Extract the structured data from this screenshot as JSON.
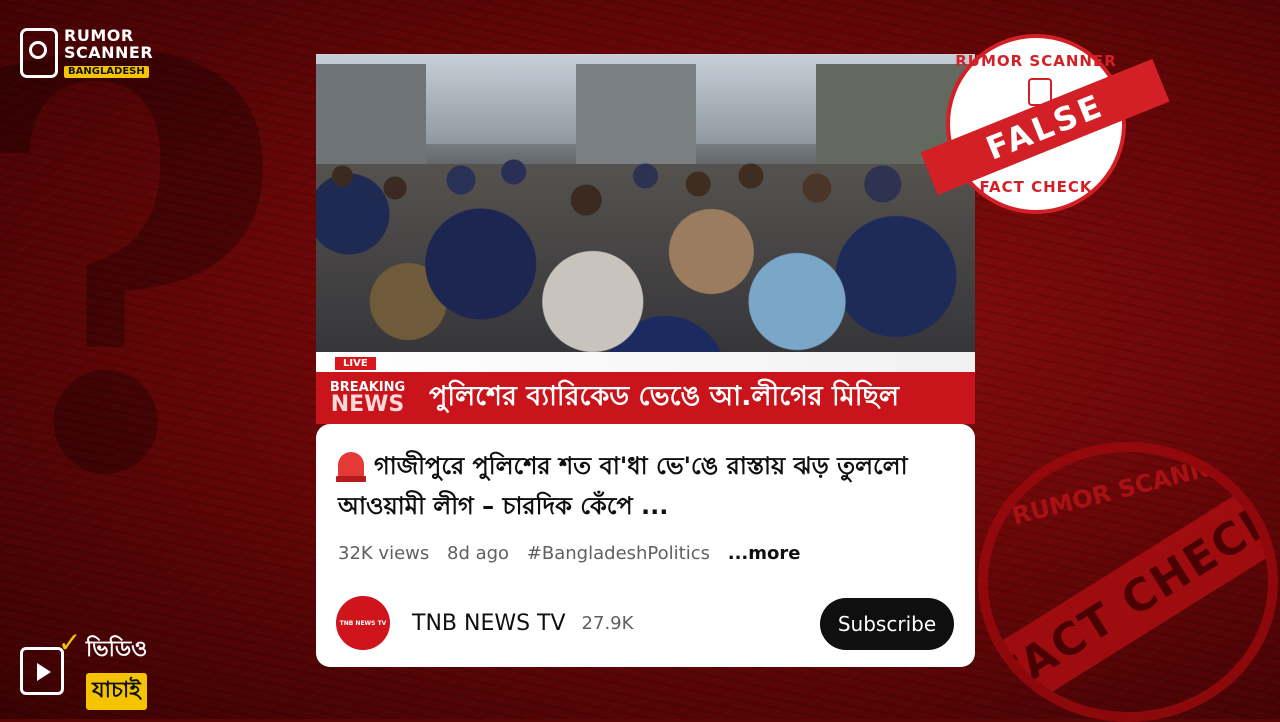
{
  "brand": {
    "line1": "RUMOR",
    "line2": "SCANNER",
    "line3": "BANGLADESH"
  },
  "badge": {
    "line1": "ভিডিও",
    "line2": "যাচাই"
  },
  "video": {
    "live_label": "LIVE",
    "breaking_line1": "BREAKING",
    "breaking_line2": "NEWS",
    "headline": "পুলিশের ব্যারিকেড ভেঙে আ.লীগের মিছিল"
  },
  "card": {
    "title": "গাজীপুরে পুলিশের শত বা'ধা ভে'ঙে রাস্তায় ঝড় তুললো আওয়ামী লীগ – চারদিক কেঁপে ...",
    "views": "32K views",
    "age": "8d ago",
    "hashtag": "#BangladeshPolitics",
    "more": "...more",
    "channel_name": "TNB NEWS TV",
    "subscribers": "27.9K",
    "avatar_text": "TNB NEWS TV",
    "subscribe_label": "Subscribe"
  },
  "stamp": {
    "top": "RUMOR SCANNER",
    "verdict": "FALSE",
    "bottom": "FACT CHECK"
  },
  "bigstamp": {
    "top": "RUMOR SCANNER",
    "band": "FACT CHECK"
  }
}
